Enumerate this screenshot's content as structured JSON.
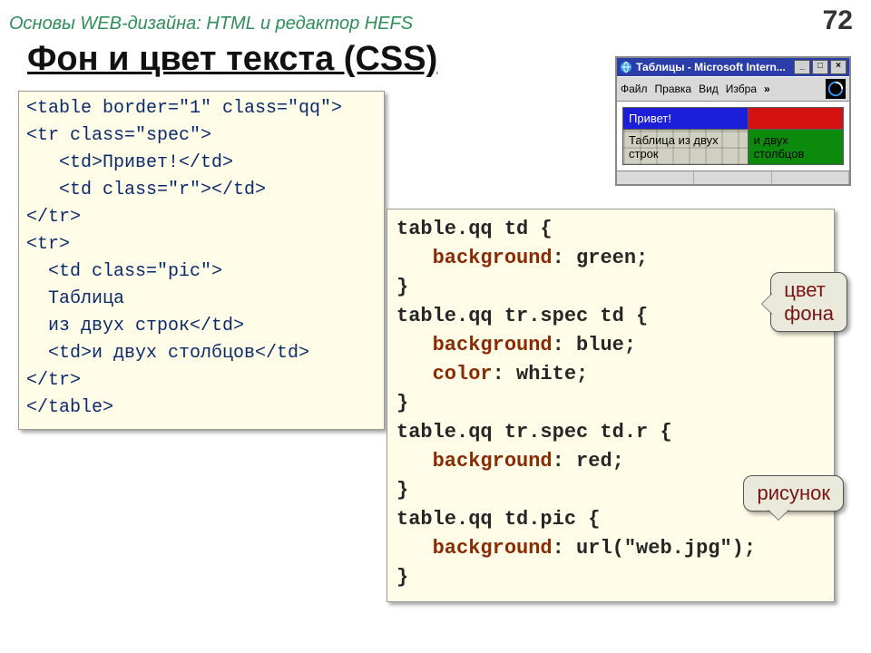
{
  "header": {
    "breadcrumb": "Основы WEB-дизайна: HTML и редактор HEFS",
    "page_number": "72"
  },
  "title": "Фон и цвет текста (CSS)",
  "html_code": {
    "raw": "<table border=\"1\" class=\"qq\">\n<tr class=\"spec\">\n   <td>Привет!</td>\n   <td class=\"r\"></td>\n</tr>\n<tr>\n  <td class=\"pic\">\n  Таблица\n  из двух строк</td>\n  <td>и двух столбцов</td>\n</tr>\n</table>"
  },
  "css_code": {
    "lines": [
      [
        "table.qq td {"
      ],
      [
        "   ",
        {
          "prop": "background"
        },
        ": green;"
      ],
      [
        "}"
      ],
      [
        "table.qq tr.spec td {"
      ],
      [
        "   ",
        {
          "prop": "background"
        },
        ": blue;"
      ],
      [
        "   ",
        {
          "prop": "color"
        },
        ": white;"
      ],
      [
        "}"
      ],
      [
        "table.qq tr.spec td.r {"
      ],
      [
        "   ",
        {
          "prop": "background"
        },
        ": red;"
      ],
      [
        "}"
      ],
      [
        "table.qq td.pic {"
      ],
      [
        "   ",
        {
          "prop": "background"
        },
        ": url(\"web.jpg\");"
      ],
      [
        "}"
      ]
    ]
  },
  "mini_window": {
    "title": "Таблицы - Microsoft Intern...",
    "menu": [
      "Файл",
      "Правка",
      "Вид",
      "Избра"
    ],
    "menu_chevron": "»",
    "cells": {
      "spec1": "Привет!",
      "spec2": "",
      "pic": "Таблица из\nдвух строк",
      "cell4": "и двух\nстолбцов"
    }
  },
  "callouts": {
    "c1_line1": "цвет",
    "c1_line2": "фона",
    "c2": "рисунок"
  }
}
